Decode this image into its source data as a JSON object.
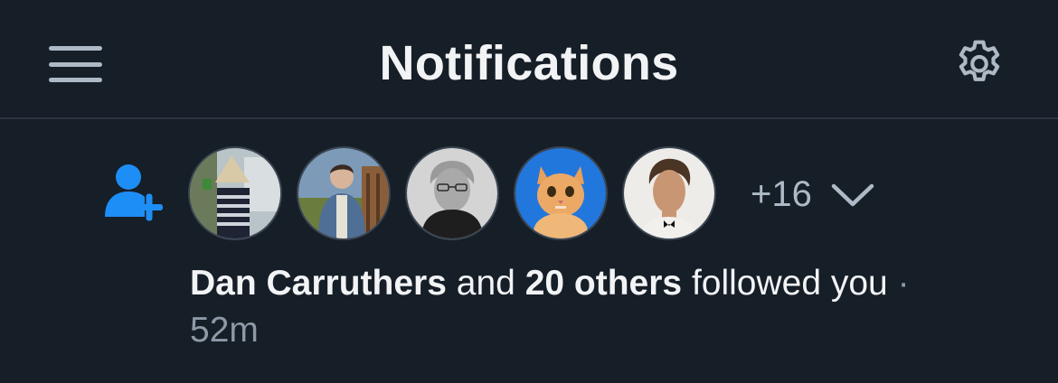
{
  "header": {
    "title": "Notifications",
    "menu_icon": "hamburger-menu-icon",
    "settings_icon": "gear-icon"
  },
  "notification": {
    "type_icon": "person-add-icon",
    "avatars": [
      {
        "alt": "avatar-1"
      },
      {
        "alt": "avatar-2"
      },
      {
        "alt": "avatar-3"
      },
      {
        "alt": "avatar-4"
      },
      {
        "alt": "avatar-5"
      }
    ],
    "more_count": "+16",
    "expand_icon": "chevron-down-icon",
    "actor": "Dan Carruthers",
    "connector": "and",
    "others": "20 others",
    "action": "followed you",
    "separator": "·",
    "time": "52m"
  },
  "colors": {
    "background": "#161e27",
    "accent": "#1d8ef5",
    "muted": "#8d99a6"
  }
}
